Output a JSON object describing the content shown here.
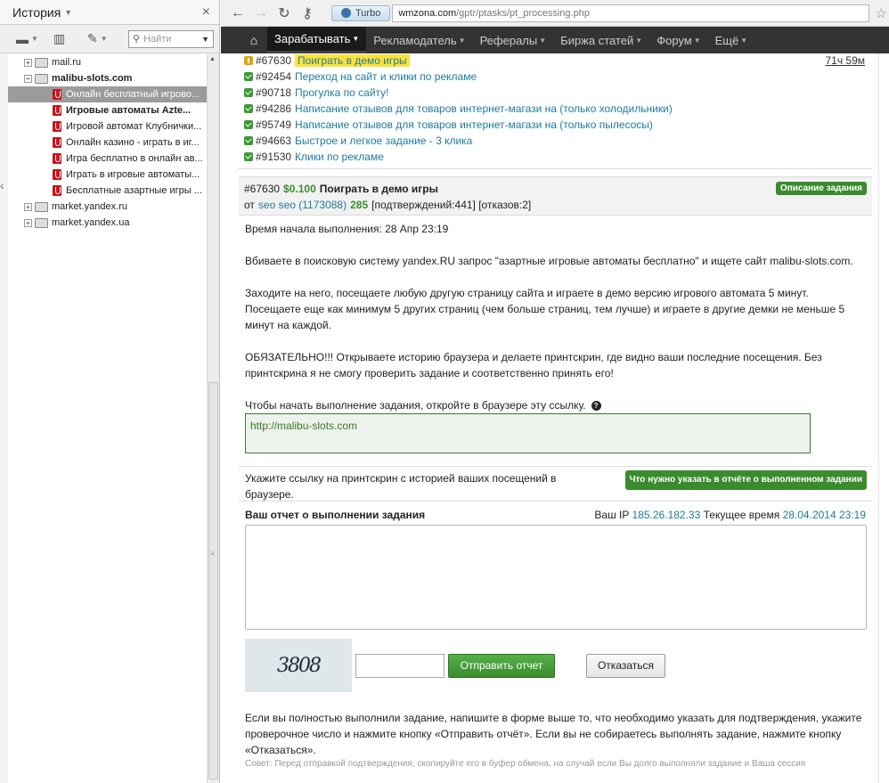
{
  "sidebar": {
    "title": "История",
    "search_placeholder": "Найти",
    "tree": [
      {
        "label": "mail.ru",
        "level": 1,
        "expander": "+"
      },
      {
        "label": "malibu-slots.com",
        "level": 1,
        "expander": "−",
        "bold": true
      },
      {
        "label": "Онлайн бесплатный игрово...",
        "level": 2,
        "selected": true
      },
      {
        "label": "Игровые автоматы Azte...",
        "level": 2,
        "bold": true
      },
      {
        "label": "Игровой автомат Клубнички...",
        "level": 2
      },
      {
        "label": "Онлайн казино - играть в иг...",
        "level": 2
      },
      {
        "label": "Игра бесплатно в онлайн ав...",
        "level": 2
      },
      {
        "label": "Играть в игровые автоматы...",
        "level": 2
      },
      {
        "label": "Бесплатные азартные игры ...",
        "level": 2
      },
      {
        "label": "market.yandex.ru",
        "level": 1,
        "expander": "+"
      },
      {
        "label": "market.yandex.ua",
        "level": 1,
        "expander": "+"
      }
    ]
  },
  "browser": {
    "turbo": "Turbo",
    "url_host": "wmzona.com",
    "url_path": "/gptr/ptasks/pt_processing.php"
  },
  "nav": {
    "items": [
      {
        "label": "Зарабатывать",
        "active": true
      },
      {
        "label": "Рекламодатель"
      },
      {
        "label": "Рефералы"
      },
      {
        "label": "Биржа статей"
      },
      {
        "label": "Форум"
      },
      {
        "label": "Ещё"
      }
    ]
  },
  "tasks": [
    {
      "id": "#67630",
      "title": "Поиграть в демо игры",
      "status": "warn",
      "highlight": true,
      "time": "71ч 59м"
    },
    {
      "id": "#92454",
      "title": "Переход на сайт и клики по рекламе",
      "status": "ok"
    },
    {
      "id": "#90718",
      "title": "Прогулка по сайту!",
      "status": "ok"
    },
    {
      "id": "#94286",
      "title": "Написание отзывов для товаров интернет-магази на (только холодильники)",
      "status": "ok"
    },
    {
      "id": "#95749",
      "title": "Написание отзывов для товаров интернет-магази на (только пылесосы)",
      "status": "ok"
    },
    {
      "id": "#94663",
      "title": "Быстрое и легкое задание - 3 клика",
      "status": "ok"
    },
    {
      "id": "#91530",
      "title": "Клики по рекламе",
      "status": "ok"
    }
  ],
  "task": {
    "id": "#67630",
    "price": "$0.100",
    "name": "Поиграть в демо игры",
    "from_label": "от",
    "author": "seo seo (1173088)",
    "rating": "285",
    "stats": "[подтверждений:441] [отказов:2]",
    "desc_badge": "Описание задания",
    "start_time": "Время начала выполнения: 28 Апр 23:19",
    "para1": "Вбиваете в поисковую систему yandex.RU запрос \"азартные игровые автоматы бесплатно\" и ищете сайт malibu-slots.com.",
    "para2": "Заходите на него, посещаете любую другую страницу сайта и играете в демо версию игрового автомата 5 минут. Посещаете еще как минимум 5 других страниц (чем больше страниц, тем лучше) и играете в другие демки не меньше 5 минут на каждой.",
    "para3": "ОБЯЗАТЕЛЬНО!!! Открываете историю браузера и делаете принтскрин, где видно ваши последние посещения. Без принтскрина я не смогу проверить задание и соответственно принять его!",
    "link_prompt": "Чтобы начать выполнение задания, откройте в браузере эту ссылку.",
    "link": "http://malibu-slots.com",
    "report_question": "Укажите ссылку на принтскрин с историей ваших посещений в браузере.",
    "report_badge": "Что нужно указать в отчёте о выполненном задании",
    "report_label": "Ваш отчет о выполнении задания",
    "ip_label": "Ваш IP",
    "ip": "185.26.182.33",
    "time_label": "Текущее время",
    "current_time": "28.04.2014 23:19",
    "captcha": "3808",
    "send_button": "Отправить отчет",
    "refuse_button": "Отказаться",
    "footer": "Если вы полностью выполнили задание, напишите в форме выше то, что необходимо указать для подтверждения, укажите проверочное число и нажмите кнопку «Отправить отчёт». Если вы не собираетесь выполнять задание, нажмите кнопку «Отказаться».",
    "tip": "Совет: Перед отправкой подтверждения, скопируйте его в буфер обмена, на случай если Вы долго выполняли задание и Ваша сессия"
  }
}
